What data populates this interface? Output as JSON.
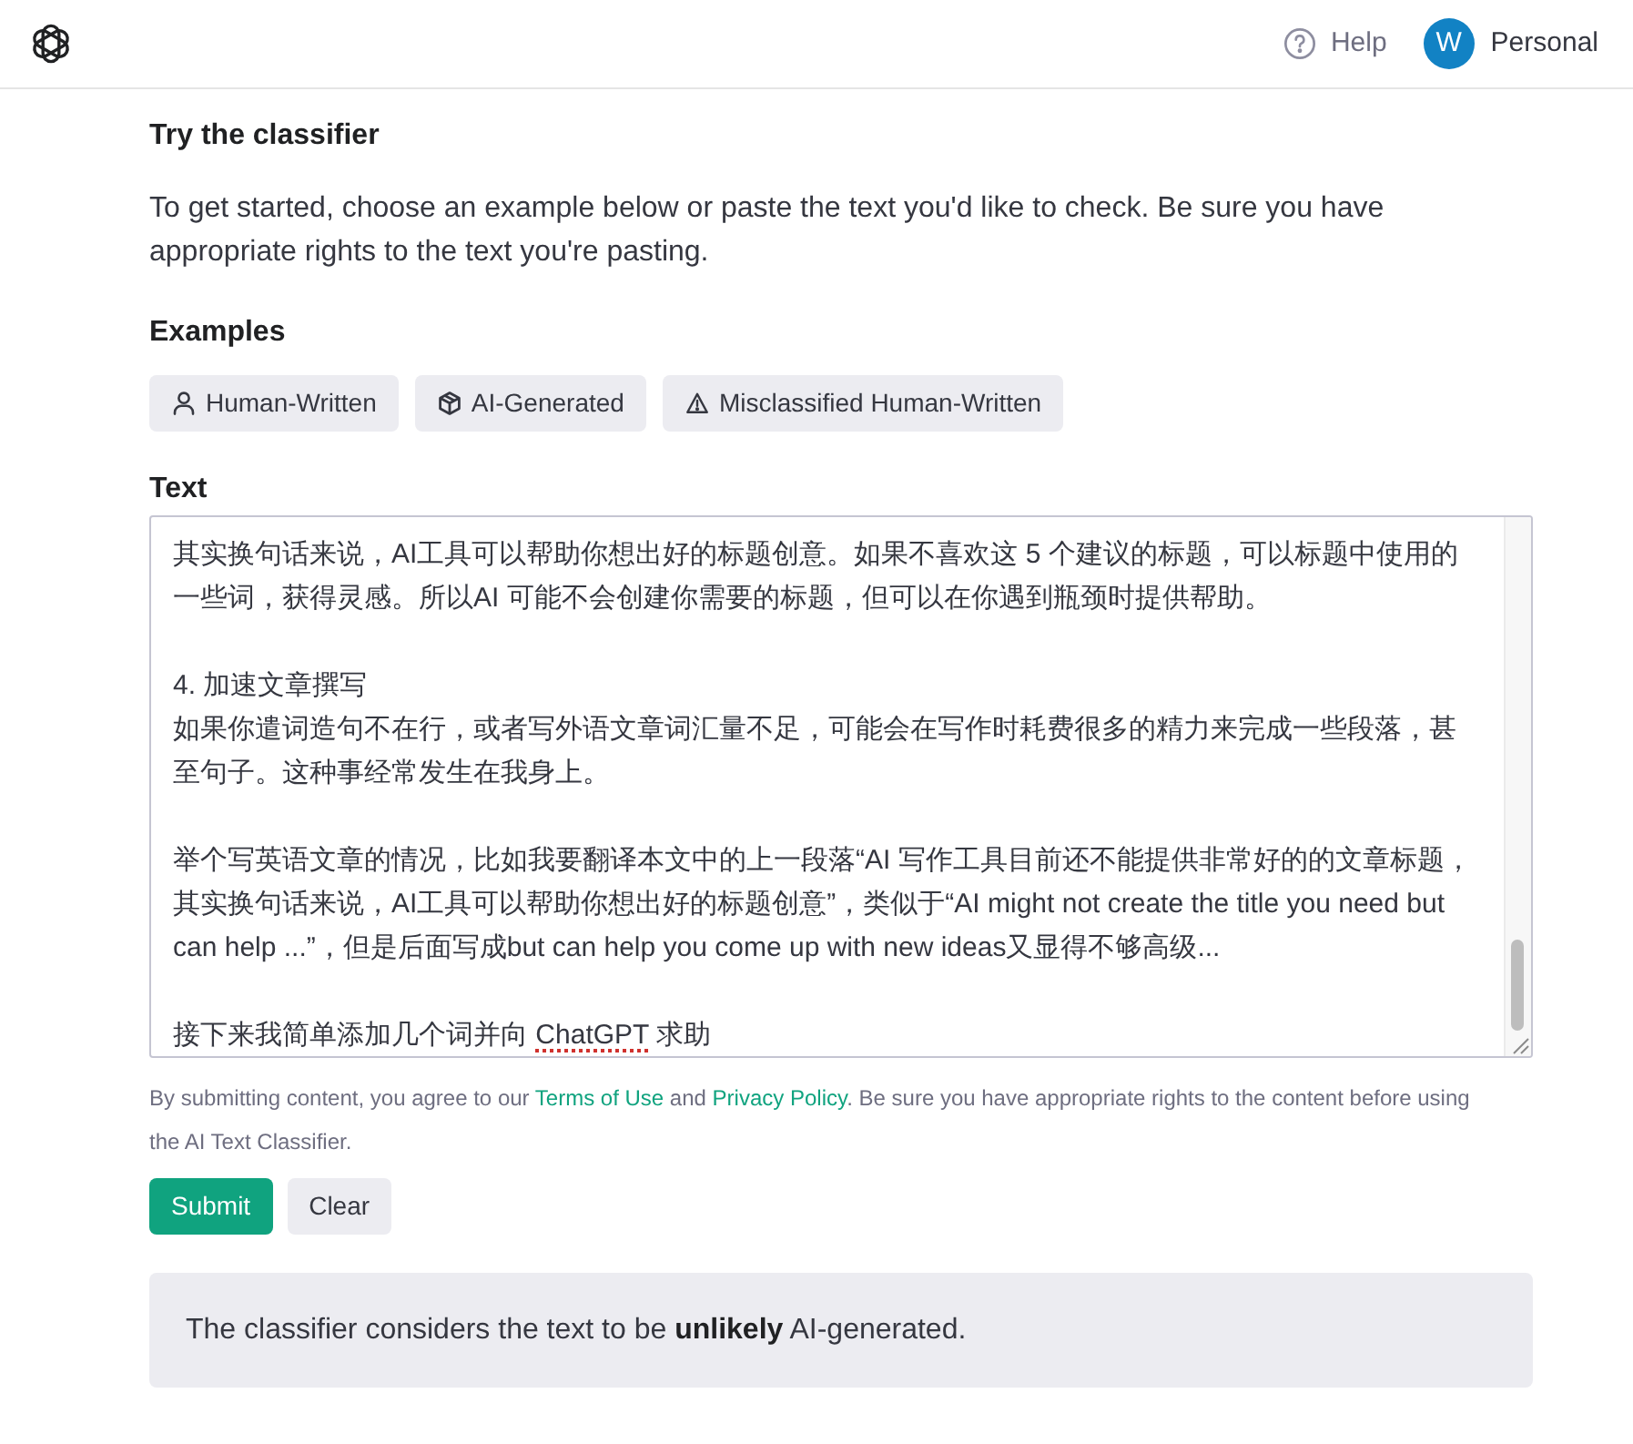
{
  "header": {
    "help_label": "Help",
    "avatar_initial": "W",
    "account_label": "Personal"
  },
  "classifier": {
    "title": "Try the classifier",
    "intro": "To get started, choose an example below or paste the text you'd like to check. Be sure you have appropriate rights to the text you're pasting.",
    "examples_heading": "Examples",
    "examples": [
      {
        "kind": "person",
        "label": "Human-Written"
      },
      {
        "kind": "cube",
        "label": "AI-Generated"
      },
      {
        "kind": "warning",
        "label": "Misclassified Human-Written"
      }
    ],
    "text_heading": "Text",
    "text_field": {
      "paragraphs": [
        {
          "lines": [
            "其实换句话来说，AI工具可以帮助你想出好的标题创意。如果不喜欢这 5 个建议的标题，可以标题中使用的",
            "一些词，获得灵感。所以AI 可能不会创建你需要的标题，但可以在你遇到瓶颈时提供帮助。"
          ]
        },
        {
          "lines": [
            "4. 加速文章撰写",
            "如果你遣词造句不在行，或者写外语文章词汇量不足，可能会在写作时耗费很多的精力来完成一些段落，甚",
            "至句子。这种事经常发生在我身上。"
          ]
        },
        {
          "lines": [
            "举个写英语文章的情况，比如我要翻译本文中的上一段落“AI 写作工具目前还不能提供非常好的的文章标题，",
            "其实换句话来说，AI工具可以帮助你想出好的标题创意”，类似于“AI might not create the title you need but",
            "can help ...”，但是后面写成but can help you come up with new ideas又显得不够高级..."
          ]
        },
        {
          "lines": [
            {
              "parts": [
                {
                  "text": "接下来我简单添加几个词并向 ",
                  "misspelled": false
                },
                {
                  "text": "ChatGPT",
                  "misspelled": true
                },
                {
                  "text": " 求助",
                  "misspelled": false
                }
              ]
            }
          ]
        }
      ]
    },
    "disclaimer": [
      {
        "kind": "text",
        "text": "By submitting content, you agree to our "
      },
      {
        "kind": "link",
        "text": "Terms of Use"
      },
      {
        "kind": "text",
        "text": " and "
      },
      {
        "kind": "link",
        "text": "Privacy Policy"
      },
      {
        "kind": "text",
        "text": ". Be sure you have appropriate rights to the content before using the AI Text Classifier."
      }
    ],
    "buttons": [
      {
        "kind": "primary",
        "label": "Submit"
      },
      {
        "kind": "secondary",
        "label": "Clear"
      }
    ],
    "result": "The classifier considers the text to be **unlikely** AI-generated."
  }
}
